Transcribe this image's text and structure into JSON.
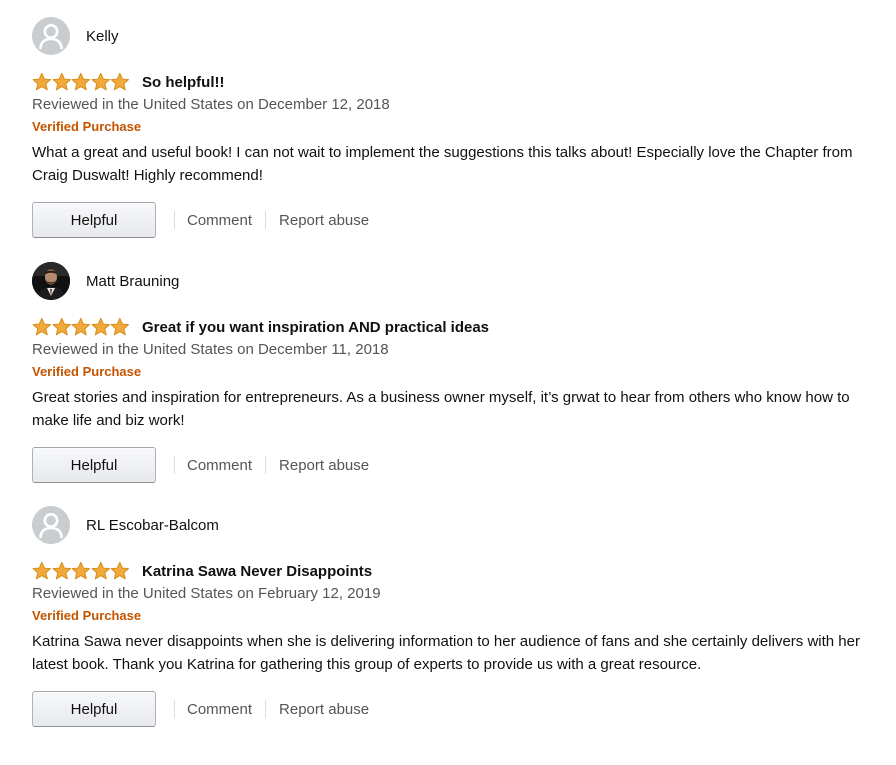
{
  "colors": {
    "star": "#f2a93b",
    "verified": "#c45500",
    "meta_text": "#555555"
  },
  "reviews": [
    {
      "author": "Kelly",
      "avatar": "default-avatar-icon",
      "rating": 5,
      "title": "So helpful!!",
      "meta": "Reviewed in the United States on December 12, 2018",
      "verified": "Verified Purchase",
      "body": "What a great and useful book! I can not wait to implement the suggestions this talks about! Especially love the Chapter from Craig Duswalt! Highly recommend!",
      "helpful_label": "Helpful",
      "comment_label": "Comment",
      "report_label": "Report abuse"
    },
    {
      "author": "Matt Brauning",
      "avatar": "user-photo-avatar",
      "rating": 5,
      "title": "Great if you want inspiration AND practical ideas",
      "meta": "Reviewed in the United States on December 11, 2018",
      "verified": "Verified Purchase",
      "body": "Great stories and inspiration for entrepreneurs. As a business owner myself, it’s grwat to hear from others who know how to make life and biz work!",
      "helpful_label": "Helpful",
      "comment_label": "Comment",
      "report_label": "Report abuse"
    },
    {
      "author": "RL Escobar-Balcom",
      "avatar": "default-avatar-icon",
      "rating": 5,
      "title": "Katrina Sawa Never Disappoints",
      "meta": "Reviewed in the United States on February 12, 2019",
      "verified": "Verified Purchase",
      "body": "Katrina Sawa never disappoints when she is delivering information to her audience of fans and she certainly delivers with her latest book. Thank you Katrina for gathering this group of experts to provide us with a great resource.",
      "helpful_label": "Helpful",
      "comment_label": "Comment",
      "report_label": "Report abuse"
    }
  ]
}
